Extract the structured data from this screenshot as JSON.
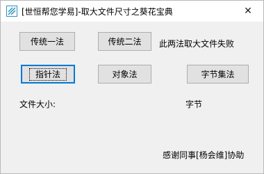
{
  "window": {
    "title": "[世恒帮您学易]-取大文件尺寸之葵花宝典",
    "close_glyph": "✕"
  },
  "buttons": {
    "method1": "传统一法",
    "method2": "传统二法",
    "pointer": "指针法",
    "object": "对象法",
    "bytes_collection": "字节集法"
  },
  "labels": {
    "both_failed": "此两法取大文件失败",
    "file_size": "文件大小:",
    "unit": "字节",
    "thanks": "感谢同事[杨会维]协助"
  },
  "colors": {
    "focus_border": "#0078d7",
    "button_bg": "#e1e1e1",
    "icon_accent": "#2a8fbd"
  }
}
